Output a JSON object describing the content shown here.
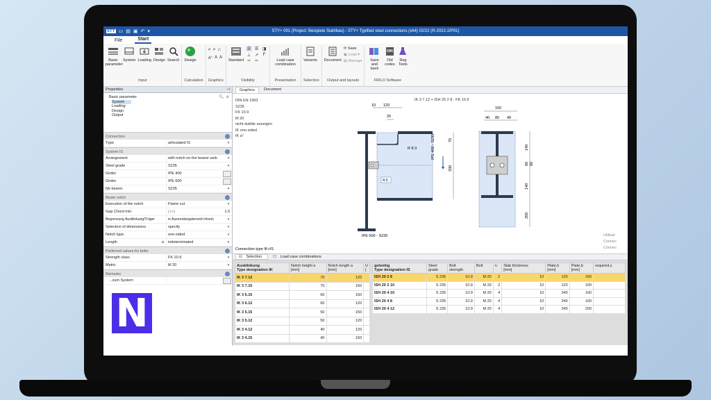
{
  "window": {
    "title": "STY+ 001 (Project: Beispiele Stahlbau) - STY+ Typified steel connections (x64) 02/22 (R-2022-2/P01)",
    "qat_logo": "STY"
  },
  "menu": {
    "file": "File",
    "start": "Start"
  },
  "ribbon": {
    "groups": [
      {
        "label": "Input",
        "buttons": [
          "Basic parameter",
          "System",
          "Loading",
          "Design",
          "Search"
        ]
      },
      {
        "label": "Calculation",
        "buttons": [
          "Design"
        ]
      },
      {
        "label": "Graphics",
        "buttons": []
      },
      {
        "label": "Visibility",
        "buttons": [
          "Standard"
        ]
      },
      {
        "label": "Presentation",
        "buttons": [
          "Load case combination"
        ]
      },
      {
        "label": "Selection",
        "buttons": [
          "Variants"
        ]
      },
      {
        "label": "Output and layouts",
        "buttons": [
          "Document",
          "Save",
          "Load",
          "Manage"
        ]
      },
      {
        "label": "FRILO Software",
        "buttons": [
          "Save and back",
          "Old codes",
          "Reg Tests"
        ]
      }
    ],
    "din_badge": "DIN"
  },
  "properties": {
    "title": "Properties",
    "pin": "⌂",
    "tree": [
      "Basic parameter",
      "System",
      "Loading",
      "Design",
      "Output"
    ],
    "sections": [
      {
        "name": "Connection",
        "rows": [
          {
            "k": "Type",
            "v": "articulated IS"
          }
        ]
      },
      {
        "name": "System IS",
        "rows": [
          {
            "k": "Arrangement",
            "v": "with notch on the bearer web"
          },
          {
            "k": "Steel grade",
            "v": "S235"
          },
          {
            "k": "Girder",
            "v": "IPE 400"
          },
          {
            "k": "Girder",
            "v": "IPE 600"
          },
          {
            "k": "fyk bearer",
            "v": "S235"
          }
        ]
      },
      {
        "name": "Beam notch",
        "rows": [
          {
            "k": "Execution of the notch",
            "v": "Flame cut"
          },
          {
            "k": "Gap Chord min",
            "v": "[cm]",
            "extra": "1.0"
          },
          {
            "k": "Begrenzung Ausklinkung/Träger",
            "v": "in Ausrundungsbereich hinein"
          },
          {
            "k": "Selection of dimensions",
            "v": "specify"
          },
          {
            "k": "Notch type",
            "v": "one-sided"
          },
          {
            "k": "Length",
            "v": "indeterminated",
            "mark": "a"
          }
        ]
      },
      {
        "name": "Preferred values for bolts",
        "rows": [
          {
            "k": "Strength class",
            "v": "FK 10.9"
          },
          {
            "k": "Metric",
            "v": "M 20"
          }
        ]
      },
      {
        "name": "Remarks",
        "rows": [
          {
            "k": "...zum System",
            "v": ""
          }
        ]
      }
    ]
  },
  "tabs": {
    "graphics": "Graphics",
    "document": "Document"
  },
  "drawing": {
    "info": [
      "DIN EN 1993",
      "S235",
      "FK 10.9",
      "M 20",
      "nicht duktile anzeigen",
      "IK one-sided",
      "IK a°"
    ],
    "headline": "IK 3 7.12 + ISH 20 2 8 - FK 10.9",
    "dims_top": [
      "10",
      "120",
      "26",
      "160",
      "40",
      "80",
      "40"
    ],
    "dims_side": [
      "70",
      "330",
      "140",
      "60",
      "60",
      "140",
      "200"
    ],
    "r_label": "R 8.3",
    "gap": "4.0",
    "beam1": "IPE 400 - S235",
    "beam2": "IPE 600 - S235",
    "connection": "Connection type IK+IS",
    "util": [
      "Utilisat",
      "Connec",
      "Connec"
    ]
  },
  "bottom_tabs": {
    "selection": "Selection",
    "lcc": "Load case combinations"
  },
  "table_left": {
    "headers": [
      "Ausklinkung\nType designation IK",
      "Notch height e\n[mm]",
      "Notch length a\n[mm]",
      "U\n["
    ],
    "rows": [
      [
        "IK 3 7.12",
        "70",
        "120"
      ],
      [
        "IK 3 7.15",
        "70",
        "150"
      ],
      [
        "IK 3 6.15",
        "60",
        "150"
      ],
      [
        "IK 3 6.12",
        "60",
        "120"
      ],
      [
        "IK 3 5.15",
        "50",
        "150"
      ],
      [
        "IK 3 5.12",
        "50",
        "120"
      ],
      [
        "IK 3 4.12",
        "40",
        "120"
      ],
      [
        "IK 3 4.15",
        "40",
        "150"
      ]
    ]
  },
  "table_right": {
    "headers": [
      "gelenkig\nType designation IS",
      "Steel\ngrade",
      "Bolt\nstrength",
      "Bolt",
      "n",
      "Slab thickness\n[mm]",
      "Plate,h\n[mm]",
      "Plate,b\n[mm]",
      "required,s"
    ],
    "rows": [
      [
        "ISH 20 2 8",
        "S 235",
        "10.9",
        "M 20",
        "2",
        "10",
        "120",
        "160"
      ],
      [
        "ISH 20 2 10",
        "S 235",
        "10.9",
        "M 20",
        "2",
        "10",
        "120",
        "160"
      ],
      [
        "ISH 20 4 10",
        "S 235",
        "10.9",
        "M 20",
        "4",
        "10",
        "240",
        "160"
      ],
      [
        "ISH 20 4 8",
        "S 235",
        "10.9",
        "M 20",
        "4",
        "10",
        "240",
        "160"
      ],
      [
        "ISH 20 4 12",
        "S 235",
        "10.9",
        "M 20",
        "4",
        "10",
        "240",
        "200"
      ]
    ]
  },
  "brand_letter": "N"
}
